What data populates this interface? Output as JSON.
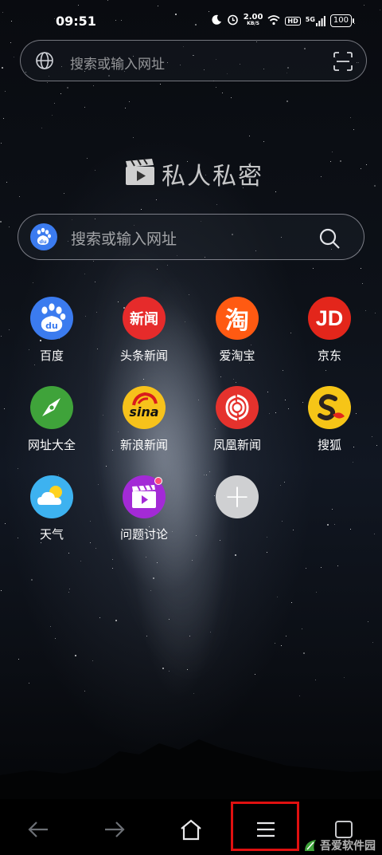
{
  "status_bar": {
    "time": "09:51",
    "net_speed_value": "2.00",
    "net_speed_unit": "KB/S",
    "hd": "HD",
    "network": "5G",
    "battery": "100"
  },
  "top_bar": {
    "placeholder": "搜索或输入网址"
  },
  "logo": {
    "text": "私人私密"
  },
  "main_search": {
    "placeholder": "搜索或输入网址",
    "engine_logo": "du"
  },
  "shortcuts": [
    {
      "label": "百度",
      "icon": "baidu-icon",
      "icon_text": "du",
      "color": "#3b7bef"
    },
    {
      "label": "头条新闻",
      "icon": "news-icon",
      "icon_text": "新闻",
      "color": "#e62b2b"
    },
    {
      "label": "爱淘宝",
      "icon": "taobao-icon",
      "icon_text": "淘",
      "color": "#ff5a12"
    },
    {
      "label": "京东",
      "icon": "jd-icon",
      "icon_text": "JD",
      "color": "#e3261b"
    },
    {
      "label": "网址大全",
      "icon": "compass-icon",
      "icon_text": "",
      "color": "#3fa33a"
    },
    {
      "label": "新浪新闻",
      "icon": "sina-icon",
      "icon_text": "sina",
      "color": "#f7c21b"
    },
    {
      "label": "凤凰新闻",
      "icon": "phoenix-icon",
      "icon_text": "",
      "color": "#e5322d"
    },
    {
      "label": "搜狐",
      "icon": "sohu-icon",
      "icon_text": "S",
      "color": "#f6c517"
    },
    {
      "label": "天气",
      "icon": "weather-icon",
      "icon_text": "",
      "color": "#3db2f0"
    },
    {
      "label": "问题讨论",
      "icon": "video-icon",
      "icon_text": "",
      "color": "#a32ad6"
    },
    {
      "label": "",
      "icon": "add-icon",
      "icon_text": "+",
      "color": "#cfd0d2"
    }
  ],
  "watermark": {
    "text": "吾爱软件园"
  }
}
